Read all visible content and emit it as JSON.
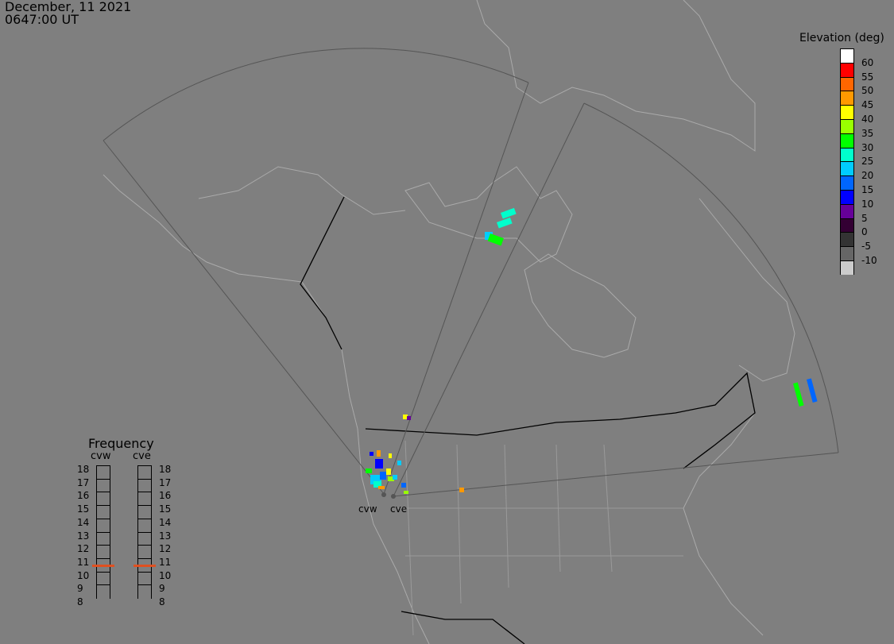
{
  "timestamp": {
    "date": "December, 11 2021",
    "time": "0647:00 UT"
  },
  "legend": {
    "title": "Elevation (deg)",
    "colors": [
      "#ffffff",
      "#ff0000",
      "#ff6600",
      "#ff9900",
      "#ffff00",
      "#99ff00",
      "#00ff00",
      "#00ffcc",
      "#00ccff",
      "#0066ff",
      "#0000ff",
      "#660099",
      "#330033",
      "#333333",
      "#666666",
      "#cccccc"
    ],
    "labels": [
      "60",
      "55",
      "50",
      "45",
      "40",
      "35",
      "30",
      "25",
      "20",
      "15",
      "10",
      "5",
      "0",
      "-5",
      "-10"
    ]
  },
  "frequency": {
    "title": "Frequency",
    "col_left": "cvw",
    "col_right": "cve",
    "levels": [
      "18",
      "17",
      "16",
      "15",
      "14",
      "13",
      "12",
      "11",
      "10",
      "9",
      "8"
    ],
    "marker_color": "#e05020",
    "cvw_mhz": 10.5,
    "cve_mhz": 10.5
  },
  "sites": {
    "west": "cvw",
    "east": "cve"
  }
}
